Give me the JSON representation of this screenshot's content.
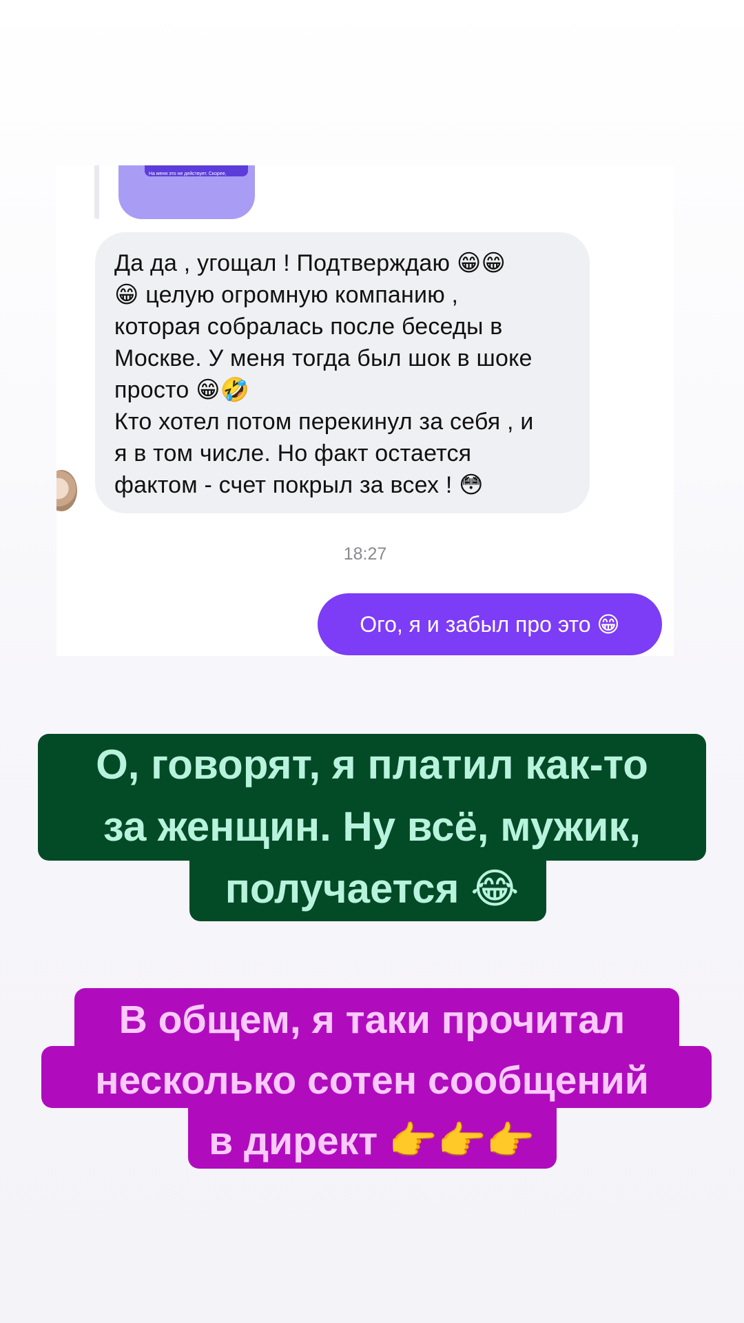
{
  "chat": {
    "reply_preview_text": "На меня это не действует. Скорее, наоборот.",
    "incoming_message": "Да да , угощал ! Подтверждаю 😁😁\n😁 целую огромную компанию ,\nкоторая собралась после беседы в\nМоскве. У меня тогда был шок в шоке\nпросто 😁🤣\nКто хотел потом перекинул за себя , и\nя в том числе. Но факт остается\nфактом - счет покрыл за всех ! 😳",
    "timestamp": "18:27",
    "outgoing_message": "Ого, я и забыл про это 😁",
    "colors": {
      "incoming_bubble": "#eff0f3",
      "outgoing_bubble": "#7d3cf5",
      "reply_preview": "#a99cf4"
    }
  },
  "captions": [
    {
      "text": "О, говорят, я платил как-то\nза женщин. Ну всё, мужик,\nполучается 😂",
      "background": "#034a26",
      "color": "#b8f3dd"
    },
    {
      "text": "В общем, я таки прочитал\nнесколько сотен сообщений\nв директ 👉👉👉",
      "background": "#b00cbe",
      "color": "#fbcafc"
    }
  ]
}
